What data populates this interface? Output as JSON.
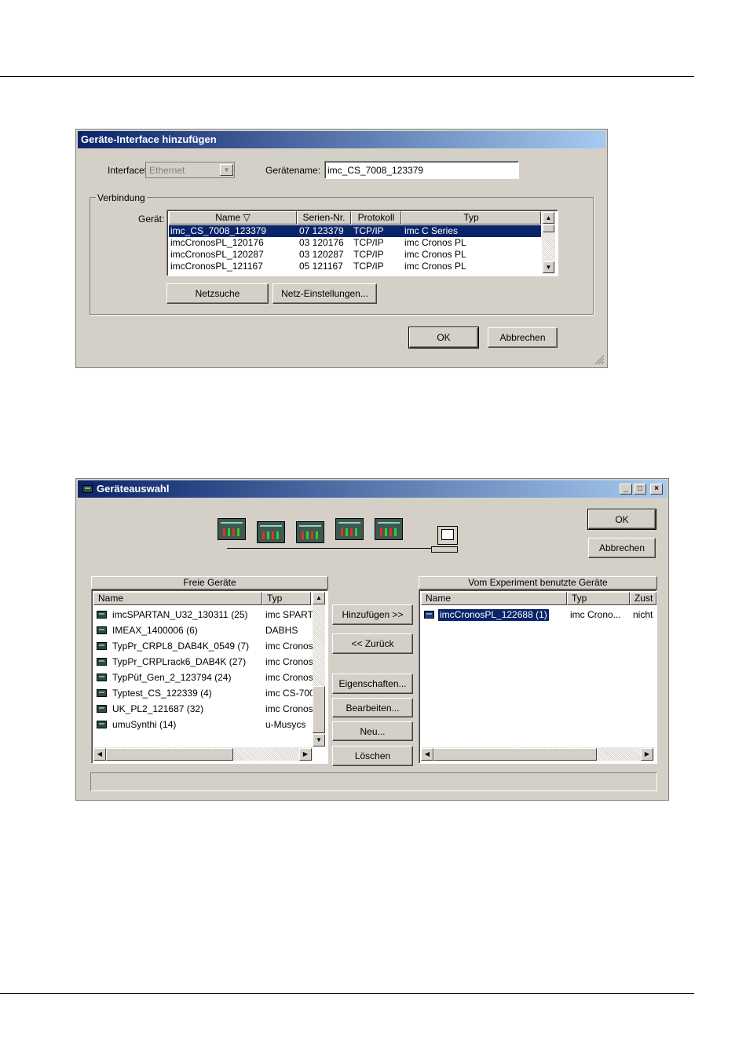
{
  "dialog1": {
    "title": "Geräte-Interface hinzufügen",
    "interfacetyp_label": "Interfacetyp:",
    "interfacetyp_value": "Ethernet",
    "geraetename_label": "Gerätename:",
    "geraetename_value": "imc_CS_7008_123379",
    "group_label": "Verbindung",
    "geraet_label": "Gerät:",
    "columns": [
      "Name ▽",
      "Serien-Nr.",
      "Protokoll",
      "Typ"
    ],
    "rows": [
      {
        "name": "imc_CS_7008_123379",
        "serial": "07 123379",
        "protocol": "TCP/IP",
        "type": "imc C Series"
      },
      {
        "name": "imcCronosPL_120176",
        "serial": "03 120176",
        "protocol": "TCP/IP",
        "type": "imc Cronos PL"
      },
      {
        "name": "imcCronosPL_120287",
        "serial": "03 120287",
        "protocol": "TCP/IP",
        "type": "imc Cronos PL"
      },
      {
        "name": "imcCronosPL_121167",
        "serial": "05 121167",
        "protocol": "TCP/IP",
        "type": "imc Cronos PL"
      }
    ],
    "netzsuche_label": "Netzsuche",
    "netzeinstellungen_label": "Netz-Einstellungen...",
    "ok_label": "OK",
    "abbrechen_label": "Abbrechen"
  },
  "dialog2": {
    "title": "Geräteauswahl",
    "ok_label": "OK",
    "abbrechen_label": "Abbrechen",
    "free_header": "Freie Geräte",
    "free_columns": [
      "Name",
      "Typ"
    ],
    "free_rows": [
      {
        "name": "imcSPARTAN_U32_130311 (25)",
        "type": "imc SPART"
      },
      {
        "name": "IMEAX_1400006 (6)",
        "type": "DABHS"
      },
      {
        "name": "TypPr_CRPL8_DAB4K_0549 (7)",
        "type": "imc Cronos"
      },
      {
        "name": "TypPr_CRPLrack6_DAB4K (27)",
        "type": "imc Cronos"
      },
      {
        "name": "TypPüf_Gen_2_123794 (24)",
        "type": "imc Cronos"
      },
      {
        "name": "Typtest_CS_122339 (4)",
        "type": "imc CS-700"
      },
      {
        "name": "UK_PL2_121687 (32)",
        "type": "imc Cronos"
      },
      {
        "name": "umuSynthi (14)",
        "type": "u-Musycs"
      }
    ],
    "used_header": "Vom Experiment benutzte Geräte",
    "used_columns": [
      "Name",
      "Typ",
      "Zust"
    ],
    "used_rows": [
      {
        "name": "imcCronosPL_122688 (1)",
        "type": "imc Crono...",
        "state": "nicht"
      }
    ],
    "hinzufuegen_label": "Hinzufügen >>",
    "zurueck_label": "<< Zurück",
    "eigenschaften_label": "Eigenschaften...",
    "bearbeiten_label": "Bearbeiten...",
    "neu_label": "Neu...",
    "loeschen_label": "Löschen"
  }
}
